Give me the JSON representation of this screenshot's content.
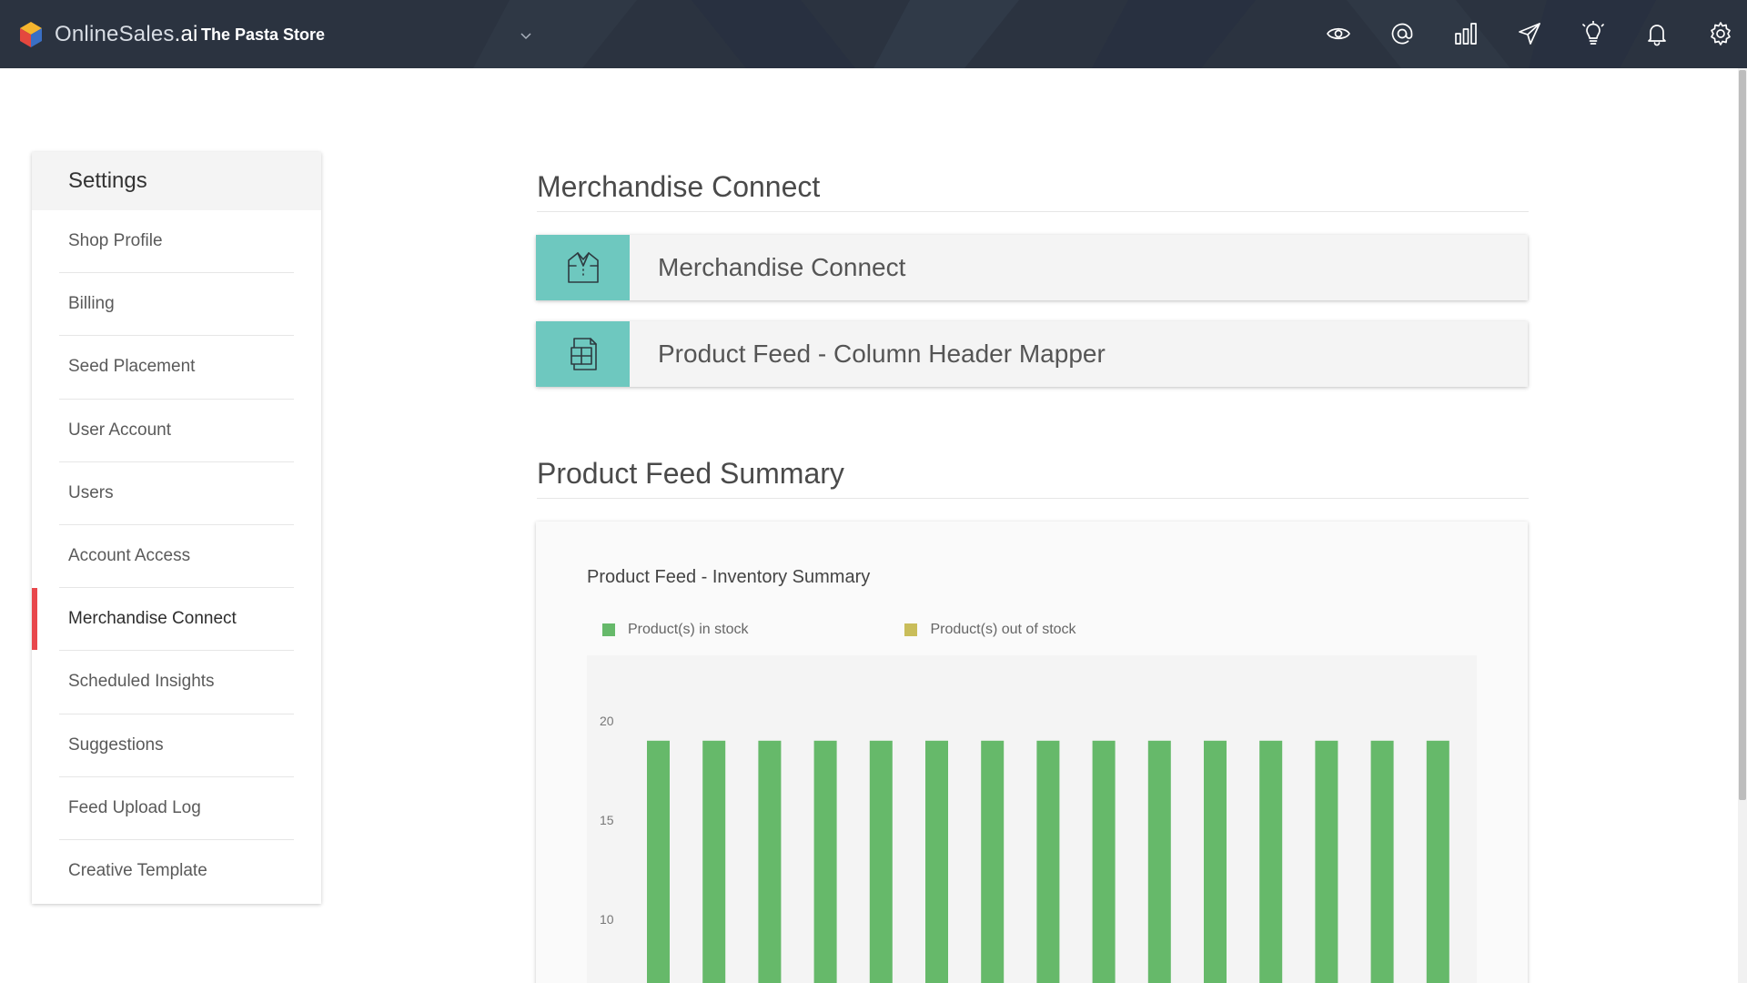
{
  "header": {
    "brand": {
      "name": "OnlineSales",
      "suffix": ".ai"
    },
    "store_name": "The Pasta Store",
    "icons": [
      "eye-icon",
      "at-sign-icon",
      "bar-chart-icon",
      "send-icon",
      "lightbulb-icon",
      "bell-icon",
      "gear-icon"
    ]
  },
  "sidebar": {
    "title": "Settings",
    "items": [
      {
        "label": "Shop Profile",
        "active": false
      },
      {
        "label": "Billing",
        "active": false
      },
      {
        "label": "Seed Placement",
        "active": false
      },
      {
        "label": "User Account",
        "active": false
      },
      {
        "label": "Users",
        "active": false
      },
      {
        "label": "Account Access",
        "active": false
      },
      {
        "label": "Merchandise Connect",
        "active": true
      },
      {
        "label": "Scheduled Insights",
        "active": false
      },
      {
        "label": "Suggestions",
        "active": false
      },
      {
        "label": "Feed Upload Log",
        "active": false
      },
      {
        "label": "Creative Template",
        "active": false
      }
    ],
    "active_color": "#e8474c"
  },
  "main": {
    "merch_section_title": "Merchandise Connect",
    "cards": [
      {
        "label": "Merchandise Connect",
        "icon": "shirt-box-icon"
      },
      {
        "label": "Product Feed - Column Header Mapper",
        "icon": "document-grid-icon"
      }
    ],
    "summary_section_title": "Product Feed Summary",
    "card_accent": "#6ec8bf"
  },
  "chart_data": {
    "type": "bar",
    "title": "Product Feed - Inventory Summary",
    "xlabel": "",
    "ylabel": "",
    "ylim": [
      5,
      22
    ],
    "yticks": [
      20,
      15,
      10
    ],
    "grid": false,
    "legend_position": "top-left",
    "series": [
      {
        "name": "Product(s) in stock",
        "color": "#66b96a",
        "values": [
          19,
          19,
          19,
          19,
          19,
          19,
          19,
          19,
          19,
          19,
          19,
          19,
          19,
          19,
          19
        ]
      },
      {
        "name": "Product(s) out of stock",
        "color": "#c9bd5a",
        "values": [
          0,
          0,
          0,
          0,
          0,
          0,
          0,
          0,
          0,
          0,
          0,
          0,
          0,
          0,
          0
        ]
      }
    ]
  }
}
